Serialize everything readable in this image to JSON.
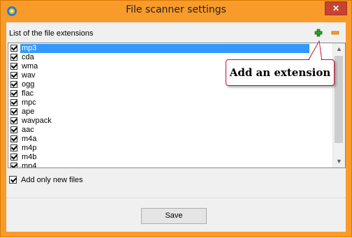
{
  "window": {
    "title": "File scanner settings",
    "close_label": "✕",
    "frame_color": "#f99b2a",
    "close_color": "#c7432f"
  },
  "list": {
    "header": "List of the file extensions",
    "add_icon": "plus-icon",
    "remove_icon": "minus-icon",
    "items": [
      {
        "label": "mp3",
        "checked": true,
        "selected": true
      },
      {
        "label": "cda",
        "checked": true
      },
      {
        "label": "wma",
        "checked": true
      },
      {
        "label": "wav",
        "checked": true
      },
      {
        "label": "ogg",
        "checked": true
      },
      {
        "label": "flac",
        "checked": true
      },
      {
        "label": "mpc",
        "checked": true
      },
      {
        "label": "ape",
        "checked": true
      },
      {
        "label": "wavpack",
        "checked": true
      },
      {
        "label": "aac",
        "checked": true
      },
      {
        "label": "m4a",
        "checked": true
      },
      {
        "label": "m4p",
        "checked": true
      },
      {
        "label": "m4b",
        "checked": true
      },
      {
        "label": "mp4",
        "checked": true
      }
    ]
  },
  "options": {
    "add_only_new_label": "Add only new files",
    "add_only_new_checked": true
  },
  "footer": {
    "save_label": "Save"
  },
  "callout": {
    "text": "Add an extension",
    "border_color": "#c8102e"
  }
}
